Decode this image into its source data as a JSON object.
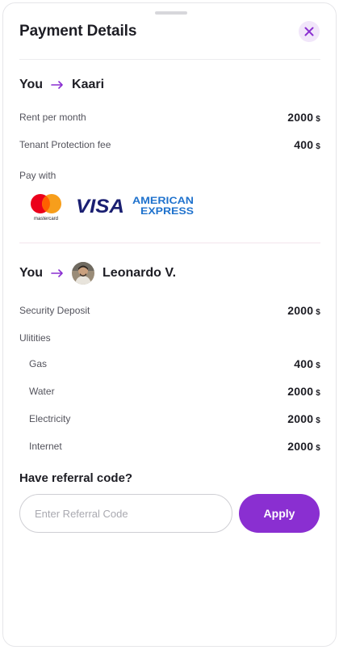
{
  "header": {
    "title": "Payment Details",
    "close_icon": "close-icon"
  },
  "colors": {
    "accent": "#8a2fd1",
    "accent_soft": "#f1e6fa",
    "text": "#1d1d24",
    "muted": "#53535c"
  },
  "section1": {
    "from": "You",
    "to": "Kaari",
    "rows": [
      {
        "label": "Rent per month",
        "value": "2000",
        "currency": "$"
      },
      {
        "label": "Tenant Protection fee",
        "value": "400",
        "currency": "$"
      }
    ],
    "pay_with_label": "Pay with",
    "payment_methods": [
      {
        "name": "mastercard",
        "text": "mastercard"
      },
      {
        "name": "visa",
        "text": "VISA"
      },
      {
        "name": "american-express",
        "line1": "AMERICAN",
        "line2": "EXPRESS"
      }
    ]
  },
  "section2": {
    "from": "You",
    "to": "Leonardo V.",
    "deposit": {
      "label": "Security Deposit",
      "value": "2000",
      "currency": "$"
    },
    "utilities_label": "Ulitities",
    "utilities": [
      {
        "label": "Gas",
        "value": "400",
        "currency": "$"
      },
      {
        "label": "Water",
        "value": "2000",
        "currency": "$"
      },
      {
        "label": "Electricity",
        "value": "2000",
        "currency": "$"
      },
      {
        "label": "Internet",
        "value": "2000",
        "currency": "$"
      }
    ]
  },
  "referral": {
    "title": "Have referral code?",
    "placeholder": "Enter Referral Code",
    "value": "",
    "apply_label": "Apply"
  }
}
